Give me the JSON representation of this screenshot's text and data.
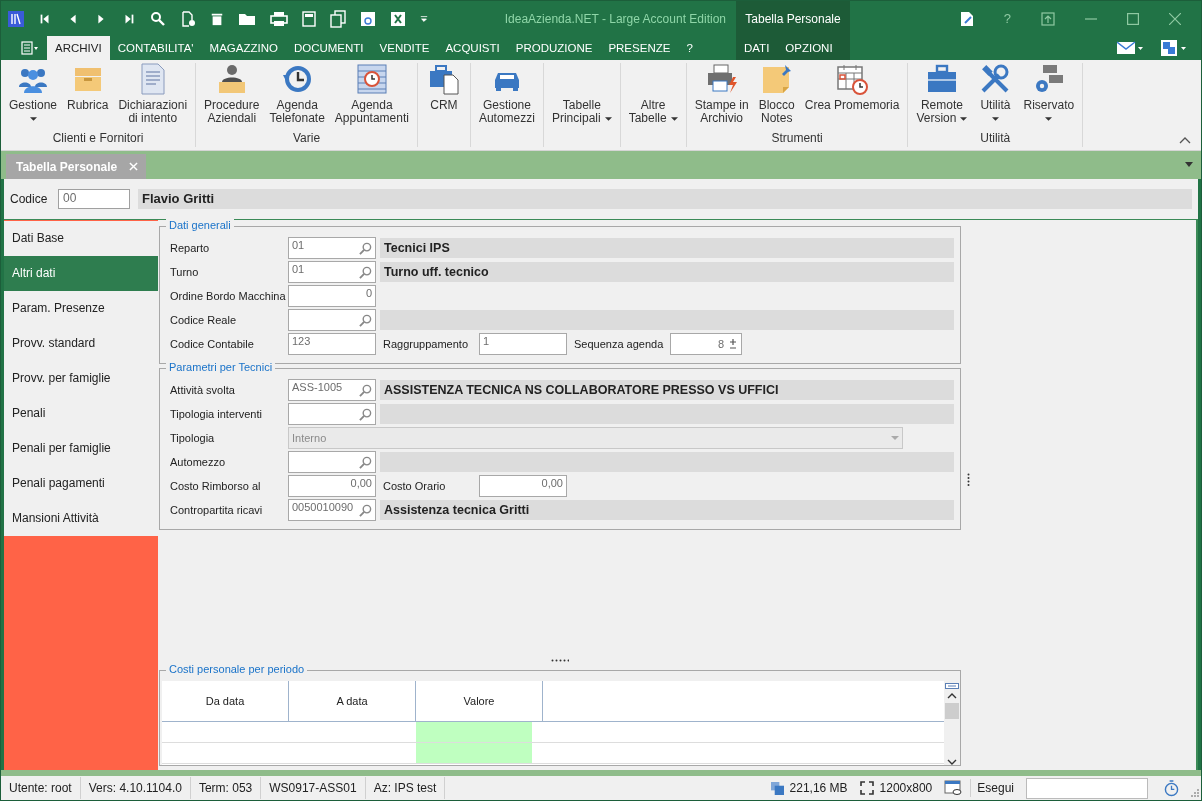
{
  "title_bar": {
    "title": "IdeaAzienda.NET - Large Account Edition",
    "context_title": "Tabella Personale",
    "help": "?"
  },
  "ribbon_tabs": [
    {
      "label": "ARCHIVI",
      "selected": true,
      "kind": "main"
    },
    {
      "label": "CONTABILITA'",
      "selected": false,
      "kind": "main"
    },
    {
      "label": "MAGAZZINO",
      "selected": false,
      "kind": "main"
    },
    {
      "label": "DOCUMENTI",
      "selected": false,
      "kind": "main"
    },
    {
      "label": "VENDITE",
      "selected": false,
      "kind": "main"
    },
    {
      "label": "ACQUISTI",
      "selected": false,
      "kind": "main"
    },
    {
      "label": "PRODUZIONE",
      "selected": false,
      "kind": "main"
    },
    {
      "label": "PRESENZE",
      "selected": false,
      "kind": "main"
    },
    {
      "label": "?",
      "selected": false,
      "kind": "main"
    },
    {
      "label": "DATI",
      "selected": false,
      "kind": "context"
    },
    {
      "label": "OPZIONI",
      "selected": false,
      "kind": "context"
    }
  ],
  "ribbon_groups": [
    {
      "label": "Clienti e Fornitori",
      "buttons": [
        {
          "kind": "people",
          "lines": [
            "Gestione"
          ],
          "dropdown": true
        },
        {
          "kind": "box",
          "lines": [
            "Rubrica"
          ],
          "dropdown": false
        },
        {
          "kind": "document",
          "lines": [
            "Dichiarazioni",
            "di intento"
          ],
          "dropdown": false
        }
      ]
    },
    {
      "label": "Varie",
      "buttons": [
        {
          "kind": "person",
          "lines": [
            "Procedure",
            "Aziendali"
          ],
          "dropdown": false
        },
        {
          "kind": "history",
          "lines": [
            "Agenda",
            "Telefonate"
          ],
          "dropdown": false
        },
        {
          "kind": "schedule",
          "lines": [
            "Agenda",
            "Appuntamenti"
          ],
          "dropdown": false
        }
      ]
    },
    {
      "buttons": [
        {
          "kind": "files",
          "lines": [
            "CRM"
          ],
          "dropdown": false
        }
      ]
    },
    {
      "buttons": [
        {
          "kind": "car",
          "lines": [
            "Gestione",
            "Automezzi"
          ],
          "dropdown": false
        }
      ]
    },
    {
      "buttons": [
        {
          "kind": "text",
          "lines": [
            "Tabelle",
            "Principali"
          ],
          "dropdown": true
        }
      ]
    },
    {
      "buttons": [
        {
          "kind": "text",
          "lines": [
            "Altre",
            "Tabelle"
          ],
          "dropdown": true
        }
      ]
    },
    {
      "label": "Strumenti",
      "buttons": [
        {
          "kind": "printer",
          "lines": [
            "Stampe in",
            "Archivio"
          ],
          "dropdown": false
        },
        {
          "kind": "note",
          "lines": [
            "Blocco",
            "Notes"
          ],
          "dropdown": false
        },
        {
          "kind": "calendar",
          "lines": [
            "Crea Promemoria"
          ],
          "dropdown": false
        }
      ]
    },
    {
      "label": "Utilità",
      "buttons": [
        {
          "kind": "briefcase",
          "lines": [
            "Remote",
            "Version"
          ],
          "dropdown": true
        },
        {
          "kind": "tools",
          "lines": [
            "Utilità"
          ],
          "dropdown": true
        },
        {
          "kind": "servers",
          "lines": [
            "Riservato"
          ],
          "dropdown": true
        }
      ]
    }
  ],
  "doc_tabs": [
    {
      "label": "Tabella Personale",
      "selected": true
    }
  ],
  "record": {
    "code_label": "Codice",
    "code": "00",
    "name": "Flavio Gritti"
  },
  "nav": [
    {
      "label": "Dati Base",
      "selected": false
    },
    {
      "label": "Altri dati",
      "selected": true
    },
    {
      "label": "Param. Presenze",
      "selected": false
    },
    {
      "label": "Provv. standard",
      "selected": false
    },
    {
      "label": "Provv. per famiglie",
      "selected": false
    },
    {
      "label": "Penali",
      "selected": false
    },
    {
      "label": "Penali per famiglie",
      "selected": false
    },
    {
      "label": "Penali pagamenti",
      "selected": false
    },
    {
      "label": "Mansioni Attività",
      "selected": false
    }
  ],
  "sections": [
    {
      "title": "Dati generali",
      "rows": [
        {
          "label": "Reparto",
          "kind": "lookup",
          "value": "01",
          "description": "Tecnici IPS"
        },
        {
          "label": "Turno",
          "kind": "lookup",
          "value": "01",
          "description": "Turno uff. tecnico"
        },
        {
          "label": "Ordine Bordo Macchina",
          "kind": "number",
          "value": "0"
        },
        {
          "label": "Codice Reale",
          "kind": "lookup"
        },
        {
          "label": "Codice Contabile",
          "kind": "text",
          "value": "123",
          "extras": [
            {
              "label": "Raggruppamento",
              "kind": "text",
              "value": "1"
            },
            {
              "label": "Sequenza agenda",
              "kind": "spin",
              "value": "8"
            }
          ]
        }
      ]
    },
    {
      "title": "Parametri per Tecnici",
      "rows": [
        {
          "label": "Attività svolta",
          "kind": "lookup",
          "value": "ASS-1005",
          "description": "ASSISTENZA TECNICA NS COLLABORATORE PRESSO VS UFFICI"
        },
        {
          "label": "Tipologia interventi",
          "kind": "lookup"
        },
        {
          "label": "Tipologia",
          "kind": "combo",
          "value": "Interno",
          "disabled": true
        },
        {
          "label": "Automezzo",
          "kind": "lookup"
        },
        {
          "label": "Costo Rimborso al",
          "kind": "number",
          "value": "0,00",
          "extras": [
            {
              "label": "Costo Orario",
              "kind": "number",
              "value": "0,00"
            }
          ]
        },
        {
          "label": "Contropartita ricavi",
          "kind": "lookup",
          "value": "0050010090",
          "description": "Assistenza tecnica Gritti"
        }
      ]
    }
  ],
  "costs": {
    "title": "Costi personale per periodo",
    "columns": [
      "Da data",
      "A data",
      "Valore"
    ]
  },
  "status_bar": {
    "items": [
      "Utente: root",
      "Vers: 4.10.1104.0",
      "Term: 053",
      "WS0917-ASS01",
      "Az: IPS test"
    ],
    "memory": "221,16 MB",
    "resolution": "1200x800",
    "run_label": "Esegui"
  }
}
